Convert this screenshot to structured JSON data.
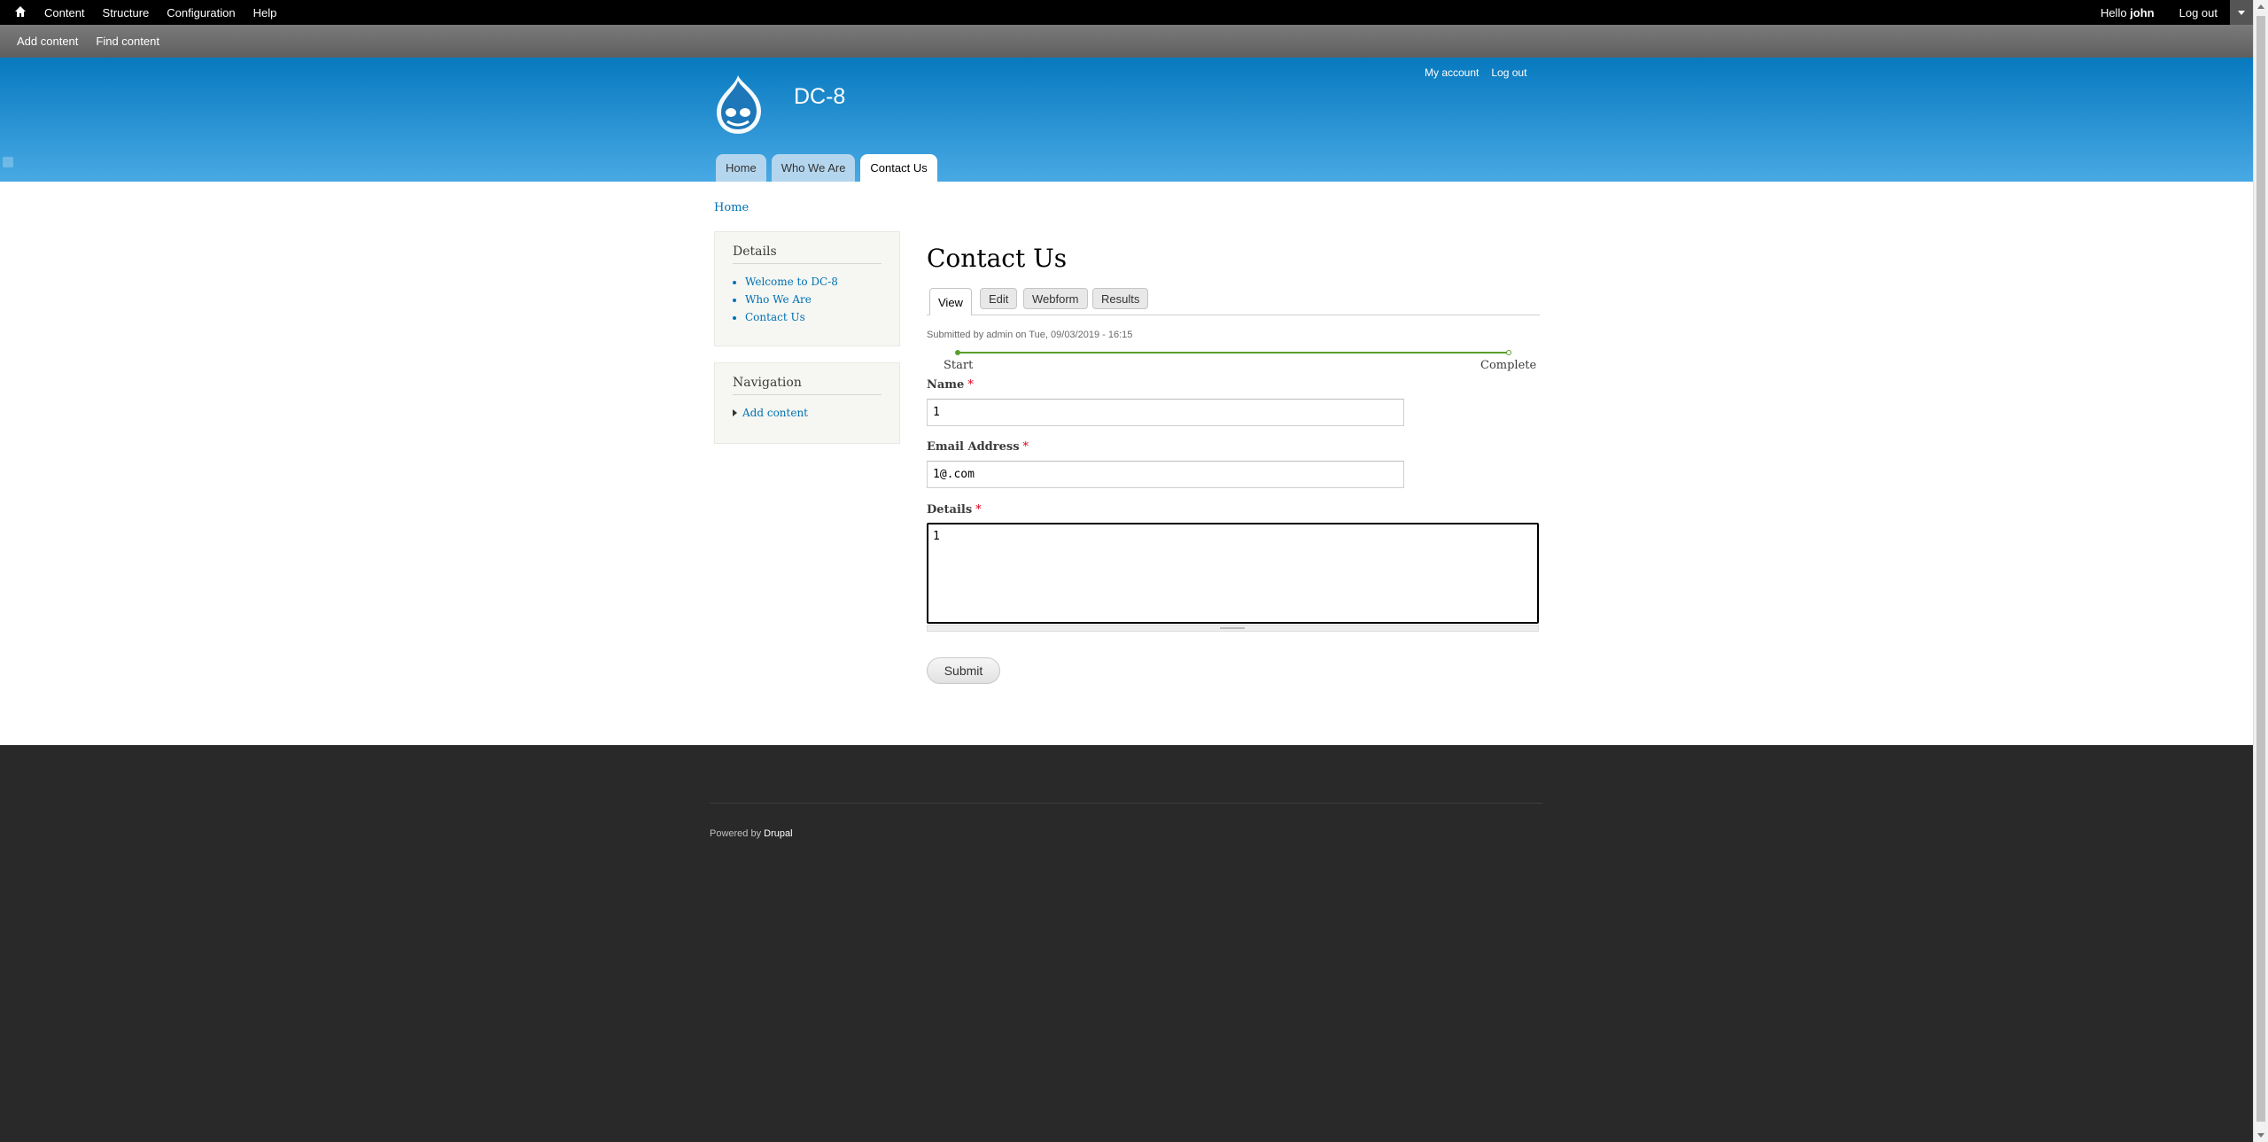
{
  "toolbar": {
    "home_icon": "home-icon",
    "items": [
      "Content",
      "Structure",
      "Configuration",
      "Help"
    ],
    "hello_prefix": "Hello",
    "username": "john",
    "logout": "Log out",
    "toggle_icon": "chevron-down-icon"
  },
  "tray": {
    "items": [
      "Add content",
      "Find content"
    ]
  },
  "header": {
    "site_name": "DC-8",
    "logo_icon": "drupal-drop-logo",
    "secondary_menu": [
      "My account",
      "Log out"
    ],
    "tabs": [
      "Home",
      "Who We Are",
      "Contact Us"
    ],
    "active_tab": "Contact Us"
  },
  "breadcrumb": "Home",
  "sidebar": {
    "details": {
      "title": "Details",
      "items": [
        "Welcome to DC-8",
        "Who We Are",
        "Contact Us"
      ]
    },
    "navigation": {
      "title": "Navigation",
      "items": [
        "Add content"
      ]
    }
  },
  "main": {
    "title": "Contact Us",
    "local_tasks": [
      "View",
      "Edit",
      "Webform",
      "Results"
    ],
    "active_task": "View",
    "submitted": "Submitted by admin on Tue, 09/03/2019 - 16:15",
    "progress": {
      "start_label": "Start",
      "end_label": "Complete",
      "color": "#5a9f2c"
    },
    "form": {
      "name_label": "Name",
      "name_value": "1",
      "email_label": "Email Address",
      "email_value": "1@.com",
      "details_label": "Details",
      "details_value": "1",
      "required_marker": "*",
      "submit_label": "Submit"
    }
  },
  "footer": {
    "powered_prefix": "Powered by",
    "powered_link": "Drupal"
  },
  "colors": {
    "header_top": "#0779bf",
    "header_bottom": "#48a9e4",
    "link": "#0071b3",
    "footer_bg": "#292929"
  }
}
